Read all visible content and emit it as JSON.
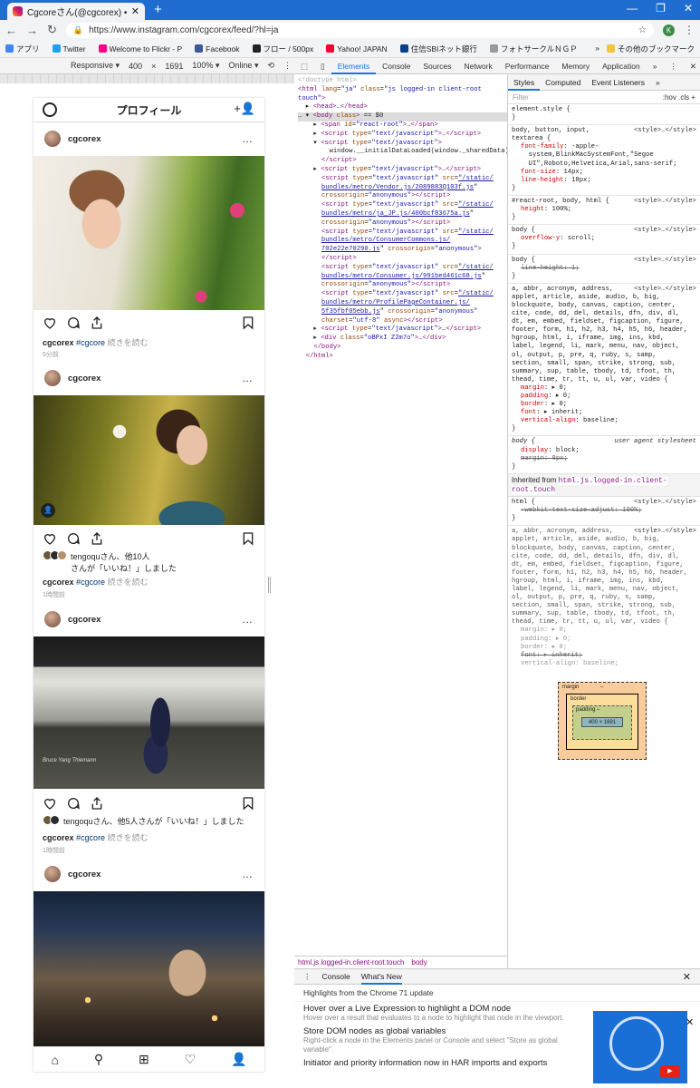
{
  "browser": {
    "tab_title": "Cgcoreさん(@cgcorex) • Instagram",
    "url": "https://www.instagram.com/cgcorex/feed/?hl=ja",
    "avatar_letter": "K",
    "bookmarks": [
      {
        "label": "アプリ",
        "color": "#4285f4"
      },
      {
        "label": "Twitter",
        "color": "#1da1f2"
      },
      {
        "label": "Welcome to Flickr - P",
        "color": "#ff0084"
      },
      {
        "label": "Facebook",
        "color": "#3b5998"
      },
      {
        "label": "フロー / 500px",
        "color": "#222222"
      },
      {
        "label": "Yahoo! JAPAN",
        "color": "#ff0033"
      },
      {
        "label": "住信SBIネット銀行",
        "color": "#0a3d8c"
      },
      {
        "label": "フォトサークルＮＧＰ",
        "color": "#999999"
      }
    ],
    "bookmarks_more": "»",
    "other_bookmarks": "その他のブックマーク"
  },
  "device_toolbar": {
    "device": "Responsive ▾",
    "width": "400",
    "times": "×",
    "height": "1691",
    "zoom": "100% ▾",
    "network": "Online ▾"
  },
  "instagram": {
    "header_title": "プロフィール",
    "posts": [
      {
        "username": "cgcorex",
        "more": "…",
        "caption_user": "cgcorex",
        "caption_tag": "#cgcore",
        "caption_more": "続きを読む",
        "time": "6分前"
      },
      {
        "username": "cgcorex",
        "more": "…",
        "likes_text": "tengoquさん、他10人",
        "likes_text2": "さんが「いいね！」しました",
        "caption_user": "cgcorex",
        "caption_tag": "#cgcore",
        "caption_more": "続きを読む",
        "time": "1時間前"
      },
      {
        "username": "cgcorex",
        "more": "…",
        "likes_text": "tengoquさん、他5人さんが「いいね！」しました",
        "caption_user": "cgcorex",
        "caption_tag": "#cgcore",
        "caption_more": "続きを読む",
        "time": "1時間前",
        "photo_signature": "Bruce Yang Thiemann"
      },
      {
        "username": "cgcorex",
        "more": "…"
      }
    ]
  },
  "devtools": {
    "tabs": [
      "Elements",
      "Console",
      "Sources",
      "Network",
      "Performance",
      "Memory",
      "Application"
    ],
    "tabs_more": "»",
    "elements_lines": [
      {
        "html": "<span class='cm'>&lt;!doctype html&gt;</span>"
      },
      {
        "html": "<span class='tg'>&lt;html</span> <span class='at'>lang</span>=<span class='av2'>\"ja\"</span> <span class='at'>class</span>=<span class='av2'>\"js logged-in client-root</span>"
      },
      {
        "html": "<span class='av2'>touch\"</span><span class='tg'>&gt;</span>"
      },
      {
        "html": "  ▸ <span class='tg'>&lt;head&gt;</span>…<span class='tg'>&lt;/head&gt;</span>"
      },
      {
        "html": "… ▾ <span class='tg'>&lt;body</span> <span class='at'>class</span><span class='tg'>&gt;</span> == $0",
        "sel": true
      },
      {
        "html": "    ▸ <span class='tg'>&lt;span</span> <span class='at'>id</span>=<span class='av2'>\"react-root\"</span><span class='tg'>&gt;</span>…<span class='tg'>&lt;/span&gt;</span>"
      },
      {
        "html": "    ▸ <span class='tg'>&lt;script</span> <span class='at'>type</span>=<span class='av2'>\"text/javascript\"</span><span class='tg'>&gt;</span>…<span class='tg'>&lt;/script&gt;</span>"
      },
      {
        "html": "    ▾ <span class='tg'>&lt;script</span> <span class='at'>type</span>=<span class='av2'>\"text/javascript\"</span><span class='tg'>&gt;</span>"
      },
      {
        "html": "        window.__initialDataLoaded(window._sharedData);"
      },
      {
        "html": "      <span class='tg'>&lt;/script&gt;</span>"
      },
      {
        "html": "    ▸ <span class='tg'>&lt;script</span> <span class='at'>type</span>=<span class='av2'>\"text/javascript\"</span><span class='tg'>&gt;</span>…<span class='tg'>&lt;/script&gt;</span>"
      },
      {
        "html": "      <span class='tg'>&lt;script</span> <span class='at'>type</span>=<span class='av2'>\"text/javascript\"</span> <span class='at'>src</span>=<span class='lk'>\"/static/</span>"
      },
      {
        "html": "      <span class='lk'>bundles/metro/Vendor.js/2089883Q103f.js</span>\""
      },
      {
        "html": "      <span class='at'>crossorigin</span>=<span class='av2'>\"anonymous\"</span><span class='tg'>&gt;&lt;/script&gt;</span>"
      },
      {
        "html": "      <span class='tg'>&lt;script</span> <span class='at'>type</span>=<span class='av2'>\"text/javascript\"</span> <span class='at'>src</span>=<span class='lk'>\"/static/</span>"
      },
      {
        "html": "      <span class='lk'>bundles/metro/ja_JP.js/400bcf83675a.js</span>\""
      },
      {
        "html": "      <span class='at'>crossorigin</span>=<span class='av2'>\"anonymous\"</span><span class='tg'>&gt;&lt;/script&gt;</span>"
      },
      {
        "html": "      <span class='tg'>&lt;script</span> <span class='at'>type</span>=<span class='av2'>\"text/javascript\"</span> <span class='at'>src</span>=<span class='lk'>\"/static/</span>"
      },
      {
        "html": "      <span class='lk'>bundles/metro/ConsumerCommons.js/</span>"
      },
      {
        "html": "      <span class='lk'>702e22e70290.js</span>\" <span class='at'>crossorigin</span>=<span class='av2'>\"anonymous\"</span><span class='tg'>&gt;</span>"
      },
      {
        "html": "      <span class='tg'>&lt;/script&gt;</span>"
      },
      {
        "html": "      <span class='tg'>&lt;script</span> <span class='at'>type</span>=<span class='av2'>\"text/javascript\"</span> <span class='at'>src</span>=<span class='lk'>\"/static/</span>"
      },
      {
        "html": "      <span class='lk'>bundles/metro/Consumer.js/991bed461c68.js</span>\""
      },
      {
        "html": "      <span class='at'>crossorigin</span>=<span class='av2'>\"anonymous\"</span><span class='tg'>&gt;&lt;/script&gt;</span>"
      },
      {
        "html": "      <span class='tg'>&lt;script</span> <span class='at'>type</span>=<span class='av2'>\"text/javascript\"</span> <span class='at'>src</span>=<span class='lk'>\"/static/</span>"
      },
      {
        "html": "      <span class='lk'>bundles/metro/ProfilePageContainer.js/</span>"
      },
      {
        "html": "      <span class='lk'>5f35fbf05ebb.js</span>\" <span class='at'>crossorigin</span>=<span class='av2'>\"anonymous\"</span>"
      },
      {
        "html": "      <span class='at'>charset</span>=<span class='av2'>\"utf-8\"</span> <span class='at'>async</span><span class='tg'>&gt;&lt;/script&gt;</span>"
      },
      {
        "html": "    ▸ <span class='tg'>&lt;script</span> <span class='at'>type</span>=<span class='av2'>\"text/javascript\"</span><span class='tg'>&gt;</span>…<span class='tg'>&lt;/script&gt;</span>"
      },
      {
        "html": "    ▸ <span class='tg'>&lt;div</span> <span class='at'>class</span>=<span class='av2'>\"oBPxI Z2m7o\"</span><span class='tg'>&gt;</span>…<span class='tg'>&lt;/div&gt;</span>"
      },
      {
        "html": "    <span class='tg'>&lt;/body&gt;</span>"
      },
      {
        "html": "  <span class='tg'>&lt;/html&gt;</span>"
      }
    ],
    "breadcrumbs": [
      "html.js.logged-in.client-root.touch",
      "body"
    ],
    "styles_tabs": [
      "Styles",
      "Computed",
      "Event Listeners"
    ],
    "styles_more": "»",
    "filter_placeholder": "Filter",
    "filter_right": ":hov  .cls  +",
    "inherited_label": "Inherited from",
    "inherited_selector": "html.js.logged-in.client-root.touch",
    "box_model": {
      "margin": "margin",
      "border": "border",
      "padding": "padding –",
      "content": "400 × 1691",
      "dash": "–"
    },
    "drawer_tabs": [
      "Console",
      "What's New"
    ],
    "drawer_subtitle": "Highlights from the Chrome 71 update",
    "drawer_items": [
      {
        "title": "Hover over a Live Expression to highlight a DOM node",
        "desc": "Hover over a result that evaluates to a node to highlight that node in the viewport."
      },
      {
        "title": "Store DOM nodes as global variables",
        "desc": "Right-click a node in the Elements panel or Console and select \"Store as global variable\"."
      },
      {
        "title": "Initiator and priority information now in HAR imports and exports",
        "desc": ""
      }
    ]
  }
}
